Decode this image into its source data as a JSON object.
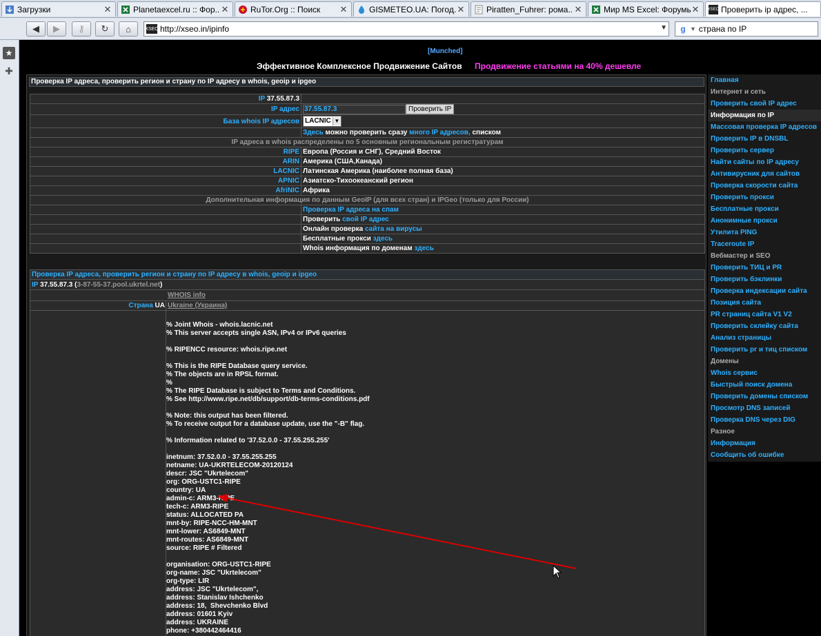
{
  "tabs": [
    {
      "title": "Загрузки",
      "icon": "downloads-icon",
      "active": false
    },
    {
      "title": "Planetaexcel.ru :: Фор...",
      "icon": "excel-icon",
      "active": false
    },
    {
      "title": "RuTor.Org :: Поиск",
      "icon": "rutor-icon",
      "active": false
    },
    {
      "title": "GISMETEO.UA: Погод...",
      "icon": "weather-icon",
      "active": false
    },
    {
      "title": "Piratten_Fuhrer: рома...",
      "icon": "page-icon",
      "active": false
    },
    {
      "title": "Мир MS Excel: Форумы",
      "icon": "excel-icon",
      "active": false
    },
    {
      "title": "Проверить ip адрес, ...",
      "icon": "xseo-icon",
      "active": true
    }
  ],
  "nav": {
    "url": "http://xseo.in/ipinfo",
    "search_value": "страна по IP"
  },
  "header": {
    "munched": "[Munched]",
    "slogan": "Эффективное Комплексное Продвижение Сайтов",
    "promo": "Продвижение статьями на 40% дешевле"
  },
  "form": {
    "section_title": "Проверка IP адреса, проверить регион и страну по IP адресу в whois, geoip и ipgeo",
    "ip_label": "IP",
    "ip_value": "37.55.87.3",
    "ip_addr_label": "IP адрес",
    "ip_input_value": "37.55.87.3",
    "check_button": "Проверить IP",
    "db_label": "База whois IP адресов",
    "db_selected": "LACNIC",
    "multi_part1": "Здесь",
    "multi_part2": "можно проверить сразу",
    "multi_part3": "много IP адресов,",
    "multi_part4": "списком",
    "registries_note": "IP адреса в whois распределены по 5 основным региональным регистратурам",
    "registries": [
      {
        "name": "RIPE",
        "desc": "Европа (Россия и СНГ), Средний Восток"
      },
      {
        "name": "ARIN",
        "desc": "Америка (США,Канада)"
      },
      {
        "name": "LACNIC",
        "desc": "Латинская Америка (наиболее полная база)"
      },
      {
        "name": "APNIC",
        "desc": "Азиатско-Тихоокеанский регион"
      },
      {
        "name": "AfriNIC",
        "desc": "Африка"
      }
    ],
    "geo_note": "Дополнительная информация по данным GeoIP (для всех стран) и IPGeo (только для России)",
    "extra_links": [
      {
        "a": "Проверка IP адреса на спам",
        "b": ""
      },
      {
        "a": "Проверить",
        "b": "свой IP адрес"
      },
      {
        "a": "Онлайн проверка",
        "b": "сайта на вирусы"
      },
      {
        "a": "Бесплатные прокси",
        "b": "здесь"
      },
      {
        "a": "Whois информация по доменам",
        "b": "здесь"
      }
    ]
  },
  "result": {
    "section_title": "Проверка IP адреса, проверить регион и страну по IP адресу в whois, geoip и ipgeo",
    "ip_label": "IP",
    "ip_value": "37.55.87.3",
    "open_paren": "(",
    "host": "3-87-55-37.pool.ukrtel.net",
    "close_paren": ")",
    "whois_info": "WHOIS info",
    "country_label": "Страна",
    "country_code": "UA",
    "country_name": "Ukraine (Украина)",
    "whois_text": "% Joint Whois - whois.lacnic.net\n% This server accepts single ASN, IPv4 or IPv6 queries\n\n% RIPENCC resource: whois.ripe.net\n\n% This is the RIPE Database query service.\n% The objects are in RPSL format.\n%\n% The RIPE Database is subject to Terms and Conditions.\n% See http://www.ripe.net/db/support/db-terms-conditions.pdf\n\n% Note: this output has been filtered.\n% To receive output for a database update, use the \"-B\" flag.\n\n% Information related to '37.52.0.0 - 37.55.255.255'\n\ninetnum: 37.52.0.0 - 37.55.255.255\nnetname: UA-UKRTELECOM-20120124\ndescr: JSC \"Ukrtelecom\"\norg: ORG-USTC1-RIPE\ncountry: UA\nadmin-c: ARM3-RIPE\ntech-c: ARM3-RIPE\nstatus: ALLOCATED PA\nmnt-by: RIPE-NCC-HM-MNT\nmnt-lower: AS6849-MNT\nmnt-routes: AS6849-MNT\nsource: RIPE # Filtered\n\norganisation: ORG-USTC1-RIPE\norg-name: JSC \"Ukrtelecom\"\norg-type: LIR\naddress: JSC \"Ukrtelecom\",\naddress: Stanislav Ishchenko\naddress: 18,  Shevchenko Blvd\naddress: 01601 Kyiv\naddress: UKRAINE\nphone: +380442464416"
  },
  "sidebar": [
    {
      "label": "Главная",
      "type": "link"
    },
    {
      "label": "Интернет и сеть",
      "type": "section"
    },
    {
      "label": "Проверить свой IP адрес",
      "type": "link"
    },
    {
      "label": "Информация по IP",
      "type": "current"
    },
    {
      "label": "Массовая проверка IP адресов",
      "type": "link"
    },
    {
      "label": "Проверить IP в DNSBL",
      "type": "link"
    },
    {
      "label": "Проверить сервер",
      "type": "link"
    },
    {
      "label": "Найти сайты по IP адресу",
      "type": "link"
    },
    {
      "label": "Антивирусник для сайтов",
      "type": "link"
    },
    {
      "label": "Проверка скорости сайта",
      "type": "link"
    },
    {
      "label": "Проверить прокси",
      "type": "link"
    },
    {
      "label": "Бесплатные прокси",
      "type": "link"
    },
    {
      "label": "Анонимные прокси",
      "type": "link"
    },
    {
      "label": "Утилита PING",
      "type": "link"
    },
    {
      "label": "Traceroute IP",
      "type": "link"
    },
    {
      "label": "Вебмастер и SEO",
      "type": "section"
    },
    {
      "label": "Проверить ТИЦ и PR",
      "type": "link"
    },
    {
      "label": "Проверить бэклинки",
      "type": "link"
    },
    {
      "label": "Проверка индексации сайта",
      "type": "link"
    },
    {
      "label": "Позиция сайта",
      "type": "link"
    },
    {
      "label": "PR страниц сайта V1 V2",
      "type": "link"
    },
    {
      "label": "Проверить склейку сайта",
      "type": "link"
    },
    {
      "label": "Анализ страницы",
      "type": "link"
    },
    {
      "label": "Проверить pr и тиц списком",
      "type": "link"
    },
    {
      "label": "Домены",
      "type": "section"
    },
    {
      "label": "Whois сервис",
      "type": "link"
    },
    {
      "label": "Быстрый поиск домена",
      "type": "link"
    },
    {
      "label": "Проверить домены списком",
      "type": "link"
    },
    {
      "label": "Просмотр DNS записей",
      "type": "link"
    },
    {
      "label": "Проверка DNS через DIG",
      "type": "link"
    },
    {
      "label": "Разное",
      "type": "section"
    },
    {
      "label": "Информация",
      "type": "link"
    },
    {
      "label": "Сообщить об ошибке",
      "type": "link"
    }
  ],
  "colors": {
    "link": "#2db0ff",
    "promo": "#ff3cf0",
    "arrow": "#dd0000"
  }
}
